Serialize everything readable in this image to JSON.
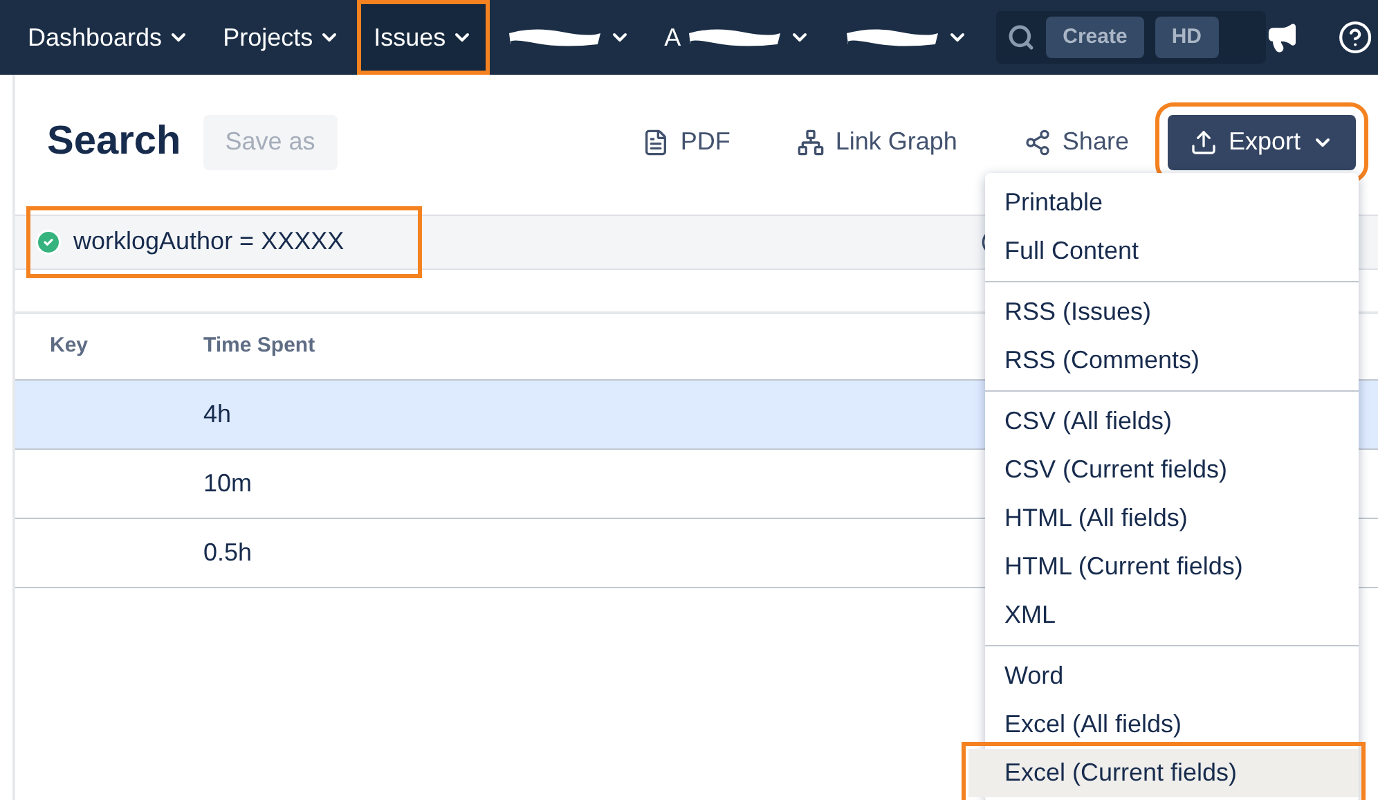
{
  "nav": {
    "items": [
      {
        "label": "Dashboards",
        "selected": false,
        "redacted": false
      },
      {
        "label": "Projects",
        "selected": false,
        "redacted": false
      },
      {
        "label": "Issues",
        "selected": true,
        "redacted": false
      },
      {
        "selected": false,
        "redacted": true
      },
      {
        "label": "A",
        "selected": false,
        "redacted": true
      },
      {
        "selected": false,
        "redacted": true
      }
    ],
    "create": "Create",
    "avatar": "HD"
  },
  "page": {
    "title": "Search",
    "save_as": "Save as",
    "actions": [
      "PDF",
      "Link Graph",
      "Share"
    ],
    "export": "Export"
  },
  "filter": {
    "query": "worklogAuthor = XXXXX",
    "valid": true
  },
  "table": {
    "columns": [
      "Key",
      "Time Spent"
    ],
    "rows": [
      {
        "time": "4h",
        "selected": true
      },
      {
        "time": "10m",
        "selected": false
      },
      {
        "time": "0.5h",
        "selected": false
      }
    ]
  },
  "export_menu": [
    {
      "items": [
        {
          "label": "Printable",
          "selected": false
        },
        {
          "label": "Full Content",
          "selected": false
        }
      ]
    },
    {
      "items": [
        {
          "label": "RSS (Issues)",
          "selected": false
        },
        {
          "label": "RSS (Comments)",
          "selected": false
        }
      ]
    },
    {
      "items": [
        {
          "label": "CSV (All fields)",
          "selected": false
        },
        {
          "label": "CSV (Current fields)",
          "selected": false
        },
        {
          "label": "HTML (All fields)",
          "selected": false
        },
        {
          "label": "HTML (Current fields)",
          "selected": false
        },
        {
          "label": "XML",
          "selected": false
        }
      ]
    },
    {
      "items": [
        {
          "label": "Word",
          "selected": false
        },
        {
          "label": "Excel (All fields)",
          "selected": false
        },
        {
          "label": "Excel (Current fields)",
          "selected": true
        }
      ]
    }
  ]
}
